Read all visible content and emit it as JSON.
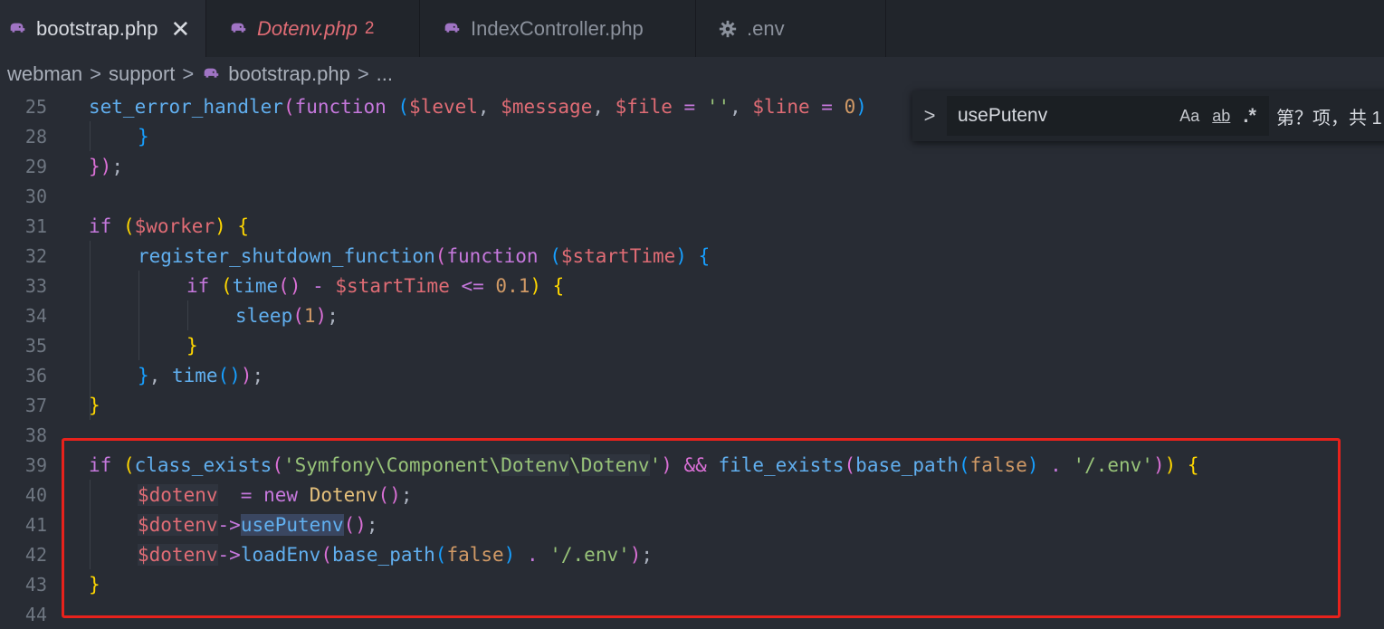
{
  "tabs": [
    {
      "label": "bootstrap.php",
      "icon": "php-elephant-icon",
      "active": true,
      "close": "✕"
    },
    {
      "label": "Dotenv.php",
      "icon": "php-elephant-icon",
      "badge": "2"
    },
    {
      "label": "IndexController.php",
      "icon": "php-elephant-icon"
    },
    {
      "label": ".env",
      "icon": "gear-icon"
    }
  ],
  "breadcrumb": {
    "items": [
      "webman",
      "support",
      "bootstrap.php",
      "..."
    ],
    "separator": ">"
  },
  "find": {
    "toggle": ">",
    "query": "usePutenv",
    "match_case": "Aa",
    "whole_word": "ab",
    "regex": ".*",
    "result": "第？项，共 1"
  },
  "line_numbers": [
    "25",
    "28",
    "29",
    "30",
    "31",
    "32",
    "33",
    "34",
    "35",
    "36",
    "37",
    "38",
    "39",
    "40",
    "41",
    "42",
    "43",
    "44"
  ],
  "code_text": {
    "l25": [
      "set_error_handler",
      "(",
      "function",
      " (",
      "$level",
      ", ",
      "$message",
      ", ",
      "$file",
      " = ",
      "''",
      ", ",
      "$line",
      " = ",
      "0",
      ")"
    ],
    "l28": [
      "}"
    ],
    "l29": [
      "}",
      ")",
      ";"
    ],
    "l31": [
      "if",
      " (",
      "$worker",
      ") ",
      "{"
    ],
    "l32": [
      "register_shutdown_function",
      "(",
      "function",
      " (",
      "$startTime",
      ") ",
      "{"
    ],
    "l33": [
      "if",
      " (",
      "time",
      "()",
      " - ",
      "$startTime",
      " <= ",
      "0.1",
      ") ",
      "{"
    ],
    "l34": [
      "sleep",
      "(",
      "1",
      ")",
      ";"
    ],
    "l35": [
      "}"
    ],
    "l36": [
      "}",
      ", ",
      "time",
      "(",
      ")",
      ")",
      ";"
    ],
    "l37": [
      "}"
    ],
    "l39": [
      "if",
      " (",
      "class_exists",
      "(",
      "'Symfony\\Component\\",
      "Dotenv",
      "\\",
      "Dotenv",
      "'",
      ") && ",
      "file_exists",
      "(",
      "base_path",
      "(",
      "false",
      ")",
      " . ",
      "'/.env'",
      ")",
      ") ",
      "{"
    ],
    "l40": [
      "$dotenv",
      "  = ",
      "new",
      " ",
      "Dotenv",
      "()",
      ";"
    ],
    "l41": [
      "$dotenv",
      "->",
      "usePutenv",
      "()",
      ";"
    ],
    "l42": [
      "$dotenv",
      "->",
      "loadEnv",
      "(",
      "base_path",
      "(",
      "false",
      ")",
      " . ",
      "'/.env'",
      ")",
      ";"
    ],
    "l43": [
      "}"
    ]
  },
  "colors": {
    "background": "#282c34",
    "highlight_box": "#e8221c",
    "keyword": "#c678dd",
    "function": "#61afef",
    "variable": "#e06c75",
    "string": "#98c379"
  }
}
